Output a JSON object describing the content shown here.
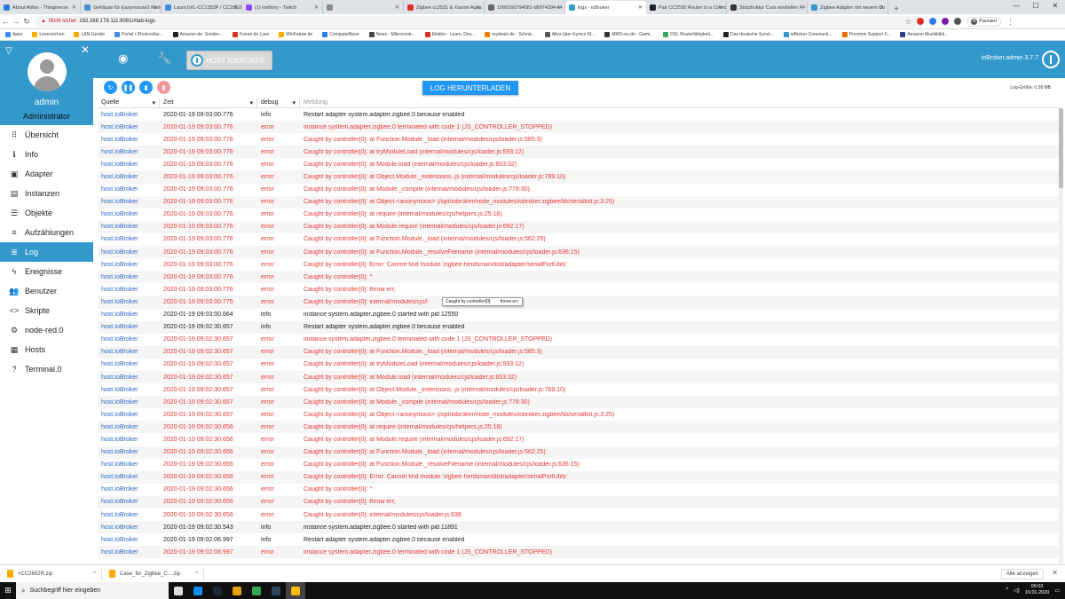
{
  "browser": {
    "tabs": [
      {
        "title": "About Atifan - Thingiverse",
        "color": "#2c7be5",
        "active": false
      },
      {
        "title": "Gehäuse für Easymouse2 Karte",
        "color": "#3f8fd2",
        "active": false
      },
      {
        "title": "LaunchXL-CC1352P / CC2652R",
        "color": "#3f8fd2",
        "active": false
      },
      {
        "title": "(1) lostfoxy - Twitch",
        "color": "#9146ff",
        "active": false
      },
      {
        "title": "",
        "color": "#888888",
        "active": false
      },
      {
        "title": "Zigbee cc2531 & Xiaomi Aqua",
        "color": "#d93025",
        "active": false
      },
      {
        "title": "1560160794681-d8974394-c4",
        "color": "#666666",
        "active": false
      },
      {
        "title": "logs - ioBroker",
        "color": "#3399cc",
        "active": true
      },
      {
        "title": "Pair CC2530 Router to a Coord",
        "color": "#222222",
        "active": false
      },
      {
        "title": "Stützfruktur Cura einstellen - F",
        "color": "#333333",
        "active": false
      },
      {
        "title": "Zigbee Adapter mit neuem Co",
        "color": "#3399cc",
        "active": false
      }
    ],
    "new_tab": "+",
    "url_warning": "Nicht sicher",
    "url": "192.168.178.111:8081/#tab-logs",
    "profile_label": "Pausiert",
    "profile_initial": "A",
    "bookmarks": [
      {
        "label": "Apps",
        "color": "#4285f4"
      },
      {
        "label": "Lesezeichen",
        "color": "#f9ab00"
      },
      {
        "label": "LAN-Geräte",
        "color": "#f9ab00"
      },
      {
        "label": "Portal • Photovoltai...",
        "color": "#3f8fd2"
      },
      {
        "label": "Amazon.de: Sonder...",
        "color": "#222222"
      },
      {
        "label": "Forum de Luxx",
        "color": "#d93025"
      },
      {
        "label": "WinFuture.de",
        "color": "#f9ab00"
      },
      {
        "label": "ComputerBase",
        "color": "#2c7be5"
      },
      {
        "label": "News - Mikrocontr...",
        "color": "#444444"
      },
      {
        "label": "Elektor - Learn, Des...",
        "color": "#d93025"
      },
      {
        "label": "mydealz.de - Schnä...",
        "color": "#f57c00"
      },
      {
        "label": "Alles über Kymco M...",
        "color": "#555555"
      },
      {
        "label": "MMO-eu.de - Gami...",
        "color": "#333333"
      },
      {
        "label": "DSL Routerfähigkeit...",
        "color": "#34a853"
      },
      {
        "label": "Das deutsche Synol...",
        "color": "#222222"
      },
      {
        "label": "ioBroker Communit...",
        "color": "#3399cc"
      },
      {
        "label": "Proxmox Support F...",
        "color": "#e57000"
      },
      {
        "label": "Amazon Musikbibli...",
        "color": "#2c3e90"
      }
    ]
  },
  "sidebar": {
    "username": "admin",
    "role": "Administrator",
    "items": [
      {
        "label": "Übersicht",
        "icon": "grid-icon",
        "glyph": "⠿",
        "active": false
      },
      {
        "label": "Info",
        "icon": "info-icon",
        "glyph": "ℹ",
        "active": false
      },
      {
        "label": "Adapter",
        "icon": "adapter-icon",
        "glyph": "▣",
        "active": false
      },
      {
        "label": "Instanzen",
        "icon": "instances-icon",
        "glyph": "▤",
        "active": false
      },
      {
        "label": "Objekte",
        "icon": "objects-icon",
        "glyph": "☰",
        "active": false
      },
      {
        "label": "Aufzählungen",
        "icon": "enums-icon",
        "glyph": "≡",
        "active": false
      },
      {
        "label": "Log",
        "icon": "log-icon",
        "glyph": "≣",
        "active": true
      },
      {
        "label": "Ereignisse",
        "icon": "lightning-icon",
        "glyph": "ϟ",
        "active": false
      },
      {
        "label": "Benutzer",
        "icon": "users-icon",
        "glyph": "👥",
        "active": false
      },
      {
        "label": "Skripte",
        "icon": "code-icon",
        "glyph": "<>",
        "active": false
      },
      {
        "label": "node-red.0",
        "icon": "node-red-icon",
        "glyph": "⚙",
        "active": false
      },
      {
        "label": "Hosts",
        "icon": "hosts-icon",
        "glyph": "▦",
        "active": false
      },
      {
        "label": "Terminal.0",
        "icon": "terminal-icon",
        "glyph": "?",
        "active": false
      }
    ]
  },
  "header": {
    "host_label": "HOST IOBROKER",
    "version": "ioBroker.admin 3.7.7"
  },
  "toolbar": {
    "download_label": "LOG HERUNTERLADEN",
    "log_size": "Log-Größe: 0.38 MB",
    "colors": {
      "refresh": "#2196f3",
      "pause": "#2196f3",
      "clear": "#2196f3",
      "delete": "#ef9a9a"
    }
  },
  "log": {
    "columns": {
      "source": "Quelle",
      "time": "Zeit",
      "level": "debug",
      "message": "Meldung"
    },
    "rows": [
      {
        "source": "host.IoBroker",
        "time": "2020-01-19 09:03:00.776",
        "level": "info",
        "message": "Restart adapter system.adapter.zigbee.0 because enabled"
      },
      {
        "source": "host.IoBroker",
        "time": "2020-01-19 09:03:00.776",
        "level": "error",
        "message": "instance system.adapter.zigbee.0 terminated with code 1 (JS_CONTROLLER_STOPPED)"
      },
      {
        "source": "host.IoBroker",
        "time": "2020-01-19 09:03:00.776",
        "level": "error",
        "message": "Caught by controller[0]: at Function.Module._load (internal/modules/cjs/loader.js:585:3)"
      },
      {
        "source": "host.IoBroker",
        "time": "2020-01-19 09:03:00.776",
        "level": "error",
        "message": "Caught by controller[0]: at tryModuleLoad (internal/modules/cjs/loader.js:593:12)"
      },
      {
        "source": "host.IoBroker",
        "time": "2020-01-19 09:03:00.776",
        "level": "error",
        "message": "Caught by controller[0]: at Module.load (internal/modules/cjs/loader.js:653:32)"
      },
      {
        "source": "host.IoBroker",
        "time": "2020-01-19 09:03:00.776",
        "level": "error",
        "message": "Caught by controller[0]: at Object.Module._extensions..js (internal/modules/cjs/loader.js:789:10)"
      },
      {
        "source": "host.IoBroker",
        "time": "2020-01-19 09:03:00.776",
        "level": "error",
        "message": "Caught by controller[0]: at Module._compile (internal/modules/cjs/loader.js:778:30)"
      },
      {
        "source": "host.IoBroker",
        "time": "2020-01-19 09:03:00.776",
        "level": "error",
        "message": "Caught by controller[0]: at Object.<anonymous> (/opt/iobroker/node_modules/iobroker.zigbee/lib/seriallist.js:3:25)"
      },
      {
        "source": "host.IoBroker",
        "time": "2020-01-19 09:03:00.776",
        "level": "error",
        "message": "Caught by controller[0]: at require (internal/modules/cjs/helpers.js:25:18)"
      },
      {
        "source": "host.IoBroker",
        "time": "2020-01-19 09:03:00.776",
        "level": "error",
        "message": "Caught by controller[0]: at Module.require (internal/modules/cjs/loader.js:692:17)"
      },
      {
        "source": "host.IoBroker",
        "time": "2020-01-19 09:03:00.776",
        "level": "error",
        "message": "Caught by controller[0]: at Function.Module._load (internal/modules/cjs/loader.js:562:25)"
      },
      {
        "source": "host.IoBroker",
        "time": "2020-01-19 09:03:00.776",
        "level": "error",
        "message": "Caught by controller[0]: at Function.Module._resolveFilename (internal/modules/cjs/loader.js:636:15)"
      },
      {
        "source": "host.IoBroker",
        "time": "2020-01-19 09:03:00.776",
        "level": "error",
        "message": "Caught by controller[0]: Error: Cannot find module 'zigbee-herdsman/dist/adapter/serialPortUtils'"
      },
      {
        "source": "host.IoBroker",
        "time": "2020-01-19 09:03:00.776",
        "level": "error",
        "message": "Caught by controller[0]: ^"
      },
      {
        "source": "host.IoBroker",
        "time": "2020-01-19 09:03:00.776",
        "level": "error",
        "message": "Caught by controller[0]: throw err;"
      },
      {
        "source": "host.IoBroker",
        "time": "2020-01-19 09:03:00.775",
        "level": "error",
        "message": "Caught by controller[0]: internal/modules/cjs/l"
      },
      {
        "source": "host.IoBroker",
        "time": "2020-01-19 09:03:00.664",
        "level": "info",
        "message": "instance system.adapter.zigbee.0 started with pid 12550"
      },
      {
        "source": "host.IoBroker",
        "time": "2020-01-19 09:02:30.657",
        "level": "info",
        "message": "Restart adapter system.adapter.zigbee.0 because enabled"
      },
      {
        "source": "host.IoBroker",
        "time": "2020-01-19 09:02:30.657",
        "level": "error",
        "message": "instance system.adapter.zigbee.0 terminated with code 1 (JS_CONTROLLER_STOPPED)"
      },
      {
        "source": "host.IoBroker",
        "time": "2020-01-19 09:02:30.657",
        "level": "error",
        "message": "Caught by controller[0]: at Function.Module._load (internal/modules/cjs/loader.js:585:3)"
      },
      {
        "source": "host.IoBroker",
        "time": "2020-01-19 09:02:30.657",
        "level": "error",
        "message": "Caught by controller[0]: at tryModuleLoad (internal/modules/cjs/loader.js:593:12)"
      },
      {
        "source": "host.IoBroker",
        "time": "2020-01-19 09:02:30.657",
        "level": "error",
        "message": "Caught by controller[0]: at Module.load (internal/modules/cjs/loader.js:653:32)"
      },
      {
        "source": "host.IoBroker",
        "time": "2020-01-19 09:02:30.657",
        "level": "error",
        "message": "Caught by controller[0]: at Object.Module._extensions..js (internal/modules/cjs/loader.js:789:10)"
      },
      {
        "source": "host.IoBroker",
        "time": "2020-01-19 09:02:30.657",
        "level": "error",
        "message": "Caught by controller[0]: at Module._compile (internal/modules/cjs/loader.js:778:30)"
      },
      {
        "source": "host.IoBroker",
        "time": "2020-01-19 09:02:30.657",
        "level": "error",
        "message": "Caught by controller[0]: at Object.<anonymous> (/opt/iobroker/node_modules/iobroker.zigbee/lib/seriallist.js:3:25)"
      },
      {
        "source": "host.IoBroker",
        "time": "2020-01-19 09:02:30.656",
        "level": "error",
        "message": "Caught by controller[0]: at require (internal/modules/cjs/helpers.js:25:18)"
      },
      {
        "source": "host.IoBroker",
        "time": "2020-01-19 09:02:30.656",
        "level": "error",
        "message": "Caught by controller[0]: at Module.require (internal/modules/cjs/loader.js:692:17)"
      },
      {
        "source": "host.IoBroker",
        "time": "2020-01-19 09:02:30.656",
        "level": "error",
        "message": "Caught by controller[0]: at Function.Module._load (internal/modules/cjs/loader.js:562:25)"
      },
      {
        "source": "host.IoBroker",
        "time": "2020-01-19 09:02:30.656",
        "level": "error",
        "message": "Caught by controller[0]: at Function.Module._resolveFilename (internal/modules/cjs/loader.js:636:15)"
      },
      {
        "source": "host.IoBroker",
        "time": "2020-01-19 09:02:30.656",
        "level": "error",
        "message": "Caught by controller[0]: Error: Cannot find module 'zigbee-herdsman/dist/adapter/serialPortUtils'"
      },
      {
        "source": "host.IoBroker",
        "time": "2020-01-19 09:02:30.656",
        "level": "error",
        "message": "Caught by controller[0]: ^"
      },
      {
        "source": "host.IoBroker",
        "time": "2020-01-19 09:02:30.656",
        "level": "error",
        "message": "Caught by controller[0]: throw err;"
      },
      {
        "source": "host.IoBroker",
        "time": "2020-01-19 09:02:30.656",
        "level": "error",
        "message": "Caught by controller[0]: internal/modules/cjs/loader.js:638"
      },
      {
        "source": "host.IoBroker",
        "time": "2020-01-19 09:02:30.543",
        "level": "info",
        "message": "instance system.adapter.zigbee.0 started with pid 11891"
      },
      {
        "source": "host.IoBroker",
        "time": "2020-01-19 09:02:06.997",
        "level": "info",
        "message": "Restart adapter system.adapter.zigbee.0 because enabled"
      },
      {
        "source": "host.IoBroker",
        "time": "2020-01-19 09:02:06.997",
        "level": "error",
        "message": "instance system.adapter.zigbee.0 terminated with code 1 (JS_CONTROLLER_STOPPED)"
      }
    ],
    "tooltip": {
      "part1": "Caught by controller[0]:",
      "part2": "throw err;"
    },
    "scroll_fraction": 0.0
  },
  "downloads": {
    "items": [
      {
        "name": "+CC2652R.zip"
      },
      {
        "name": "Case_for_Zigbee_C....zip"
      }
    ],
    "show_all": "Alle anzeigen"
  },
  "taskbar": {
    "search_placeholder": "Suchbegriff hier eingeben",
    "apps": [
      {
        "icon": "task-view-icon",
        "color": "#dddddd"
      },
      {
        "icon": "teamviewer-icon",
        "color": "#0e8ee9"
      },
      {
        "icon": "steam-icon",
        "color": "#1b2838"
      },
      {
        "icon": "plex-icon",
        "color": "#e5a00d"
      },
      {
        "icon": "chrome-icon",
        "color": "#34a853"
      },
      {
        "icon": "steam2-icon",
        "color": "#2a475e"
      },
      {
        "icon": "chrome-active-icon",
        "color": "#fbbc05"
      }
    ],
    "time": "09:03",
    "date": "19.01.2020"
  }
}
